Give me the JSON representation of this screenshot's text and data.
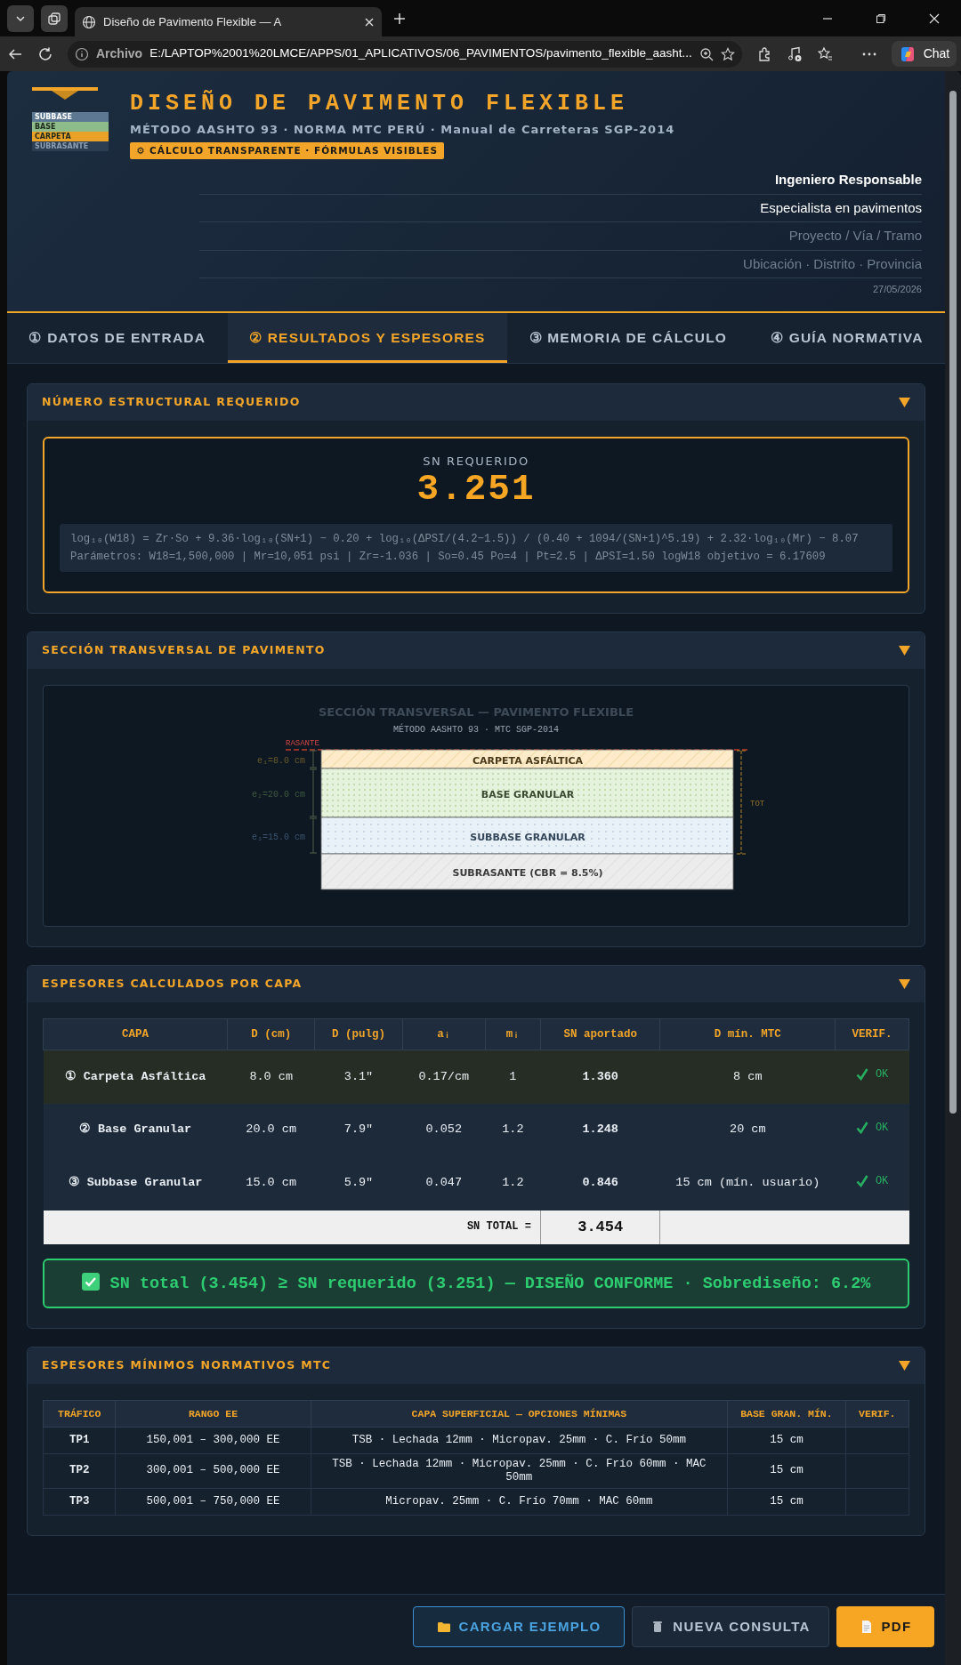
{
  "browser": {
    "tab_title": "Diseño de Pavimento Flexible — A",
    "address_label": "Archivo",
    "url": "E:/LAPTOP%2001%20LMCE/APPS/01_APLICATIVOS/06_PAVIMENTOS/pavimento_flexible_aasht...",
    "chat": "Chat"
  },
  "header": {
    "logo_layers": [
      {
        "label": "SUBBASE",
        "color": "#5d7893"
      },
      {
        "label": "BASE",
        "color": "#8dbb8a"
      },
      {
        "label": "CARPETA",
        "color": "#e9a227"
      },
      {
        "label": "SUBRASANTE",
        "color": "#2c3e52"
      }
    ],
    "title": "DISEÑO DE PAVIMENTO FLEXIBLE",
    "subtitle": "MÉTODO AASHTO 93 · NORMA MTC PERÚ · Manual de Carreteras SGP-2014",
    "badge": "⚙ CÁLCULO TRANSPARENTE · FÓRMULAS VISIBLES",
    "fields": [
      {
        "value": "Ingeniero Responsable",
        "kind": "strong"
      },
      {
        "value": "Especialista en pavimentos",
        "kind": "plain"
      },
      {
        "placeholder": "Proyecto / Vía / Tramo",
        "kind": "plain"
      },
      {
        "placeholder": "Ubicación · Distrito · Provincia",
        "kind": "plain"
      }
    ],
    "date": "27/05/2026"
  },
  "tabs": [
    {
      "label": "① DATOS DE ENTRADA",
      "selected": false
    },
    {
      "label": "② RESULTADOS Y ESPESORES",
      "selected": true
    },
    {
      "label": "③ MEMORIA DE CÁLCULO",
      "selected": false
    },
    {
      "label": "④ GUÍA NORMATIVA",
      "selected": false
    }
  ],
  "sn_section": {
    "title": "NÚMERO ESTRUCTURAL REQUERIDO",
    "expanded": true,
    "label": "SN REQUERIDO",
    "value": "3.251",
    "formula": "log₁₀(W18) = Zr·So + 9.36·log₁₀(SN+1) − 0.20 + log₁₀(ΔPSI/(4.2−1.5)) / (0.40 + 1094/(SN+1)^5.19) + 2.32·log₁₀(Mr) − 8.07",
    "parameters": "Parámetros: W18=1,500,000 | Mr=10,051 psi | Zr=-1.036 | So=0.45 Po=4 | Pt=2.5 | ΔPSI=1.50 logW18 objetivo = 6.17609"
  },
  "section_view": {
    "title": "SECCIÓN TRANSVERSAL DE PAVIMENTO",
    "expanded": true,
    "drawing_title": "SECCIÓN TRANSVERSAL — PAVIMENTO FLEXIBLE",
    "drawing_subtitle": "MÉTODO AASHTO 93 · MTC SGP-2014",
    "top_label": "RASANTE",
    "total_label": "TOT",
    "layers": [
      {
        "kind": "asphalt",
        "label": "CARPETA ASFÁLTICA",
        "thickness": "e₁=8.0 cm"
      },
      {
        "kind": "base",
        "label": "BASE GRANULAR",
        "thickness": "e₂=20.0 cm"
      },
      {
        "kind": "subbase",
        "label": "SUBBASE GRANULAR",
        "thickness": "e₃=15.0 cm"
      },
      {
        "kind": "subgrade",
        "label": "SUBRASANTE (CBR = 8.5%)"
      }
    ]
  },
  "thickness_section": {
    "title": "ESPESORES CALCULADOS POR CAPA",
    "expanded": true,
    "columns": [
      "CAPA",
      "D (cm)",
      "D (pulg)",
      "aᵢ",
      "mᵢ",
      "SN aportado",
      "D mín. MTC",
      "VERIF."
    ],
    "rows": [
      {
        "cells": [
          "① Carpeta Asfáltica",
          "8.0 cm",
          "3.1\"",
          "0.17/cm",
          "1",
          "1.360",
          "8 cm"
        ],
        "verif": "OK",
        "ok": true,
        "selected": true
      },
      {
        "cells": [
          "② Base Granular",
          "20.0 cm",
          "7.9\"",
          "0.052",
          "1.2",
          "1.248",
          "20 cm"
        ],
        "verif": "OK",
        "ok": true,
        "selected": false
      },
      {
        "cells": [
          "③ Subbase Granular",
          "15.0 cm",
          "5.9\"",
          "0.047",
          "1.2",
          "0.846",
          "15 cm (mín. usuario)"
        ],
        "verif": "OK",
        "ok": true,
        "selected": false
      }
    ],
    "total_label": "SN TOTAL =",
    "total_value": "3.454",
    "result": {
      "text": "SN total (3.454) ≥ SN requerido (3.251) — DISEÑO CONFORME · Sobrediseño: 6.2%",
      "ok": true
    }
  },
  "minimums_section": {
    "title": "ESPESORES MÍNIMOS NORMATIVOS MTC",
    "expanded": true,
    "columns": [
      "TRÁFICO",
      "RANGO EE",
      "CAPA SUPERFICIAL — OPCIONES MÍNIMAS",
      "BASE GRAN. MÍN.",
      "VERIF."
    ],
    "rows": [
      [
        "TP1",
        "150,001 – 300,000 EE",
        "TSB · Lechada 12mm · Micropav. 25mm · C. Frío 50mm",
        "15 cm"
      ],
      [
        "TP2",
        "300,001 – 500,000 EE",
        "TSB · Lechada 12mm · Micropav. 25mm · C. Frío 60mm · MAC 50mm",
        "15 cm"
      ],
      [
        "TP3",
        "500,001 – 750,000 EE",
        "Micropav. 25mm · C. Frío 70mm · MAC 60mm",
        "15 cm"
      ]
    ]
  },
  "actions": [
    {
      "kind": "load",
      "label": "CARGAR EJEMPLO"
    },
    {
      "kind": "clear",
      "label": "NUEVA CONSULTA"
    },
    {
      "kind": "pdf",
      "label": "PDF"
    }
  ]
}
